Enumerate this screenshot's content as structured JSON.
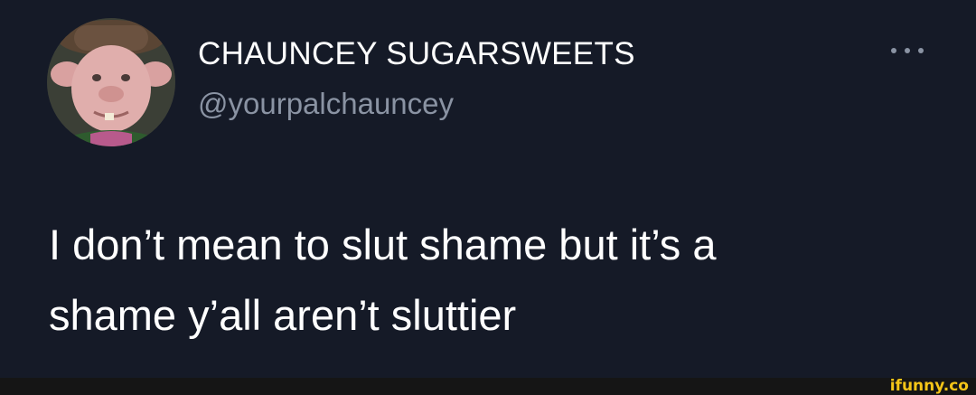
{
  "author": {
    "display_name": "CHAUNCEY SUGARSWEETS",
    "handle": "@yourpalchauncey"
  },
  "tweet": {
    "lines": [
      "I don’t mean to slut shame but it’s a",
      "shame y’all aren’t sluttier"
    ]
  },
  "menu": {
    "icon": "more-horizontal-icon"
  },
  "watermark": {
    "text": "ifunny.co"
  },
  "colors": {
    "background": "#151a27",
    "name": "#ffffff",
    "handle": "#8a93a3",
    "watermark": "#f5c518"
  }
}
